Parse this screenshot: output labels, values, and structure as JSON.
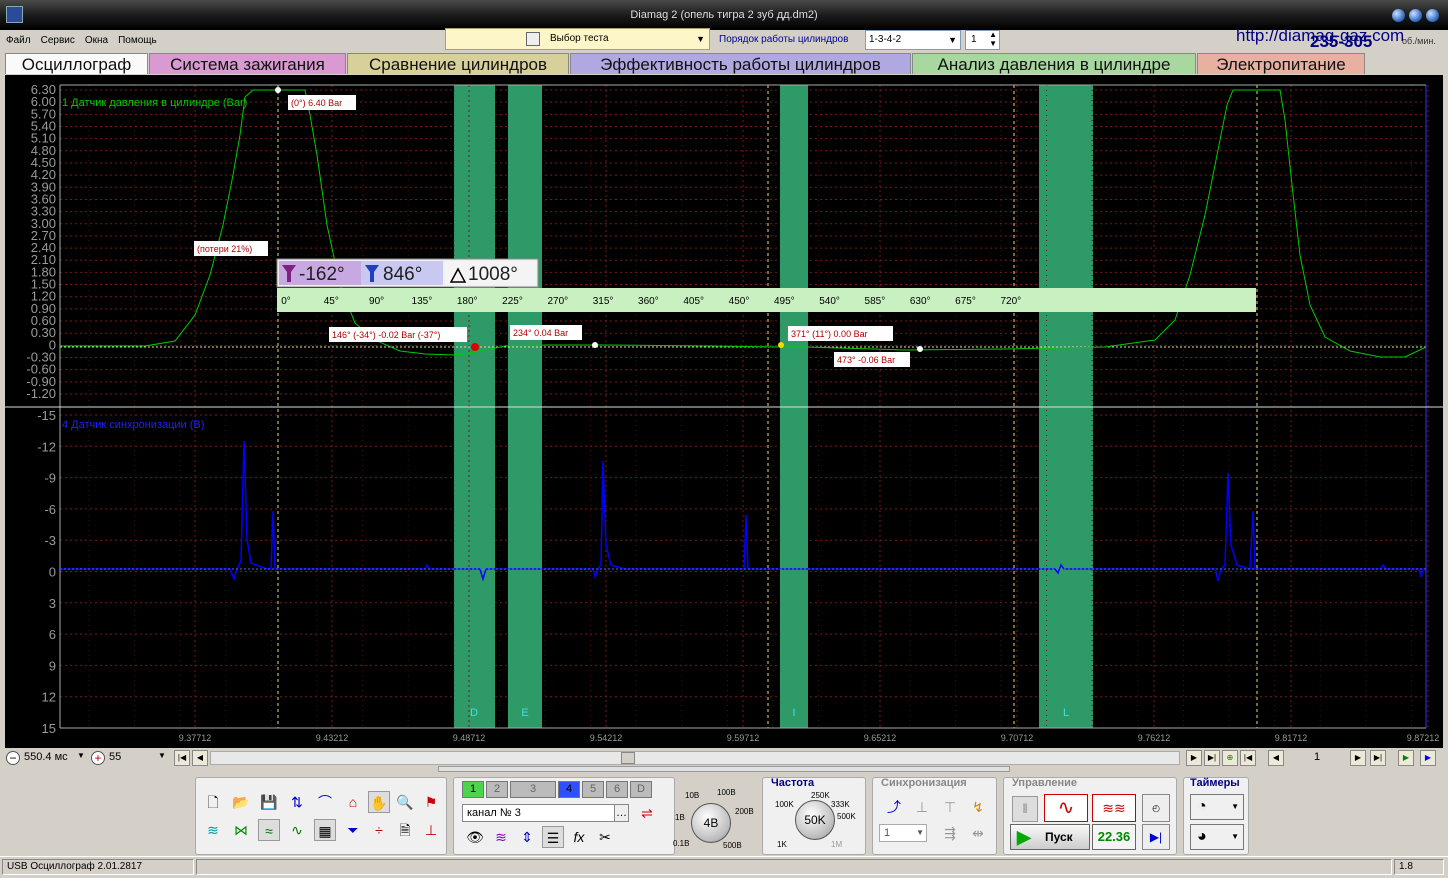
{
  "window": {
    "title": "Diamag 2 (опель тигра 2 зуб дд.dm2)"
  },
  "menu": [
    "Файл",
    "Сервис",
    "Окна",
    "Помощь"
  ],
  "toolbar": {
    "test_select": "Выбор теста",
    "order_label": "Порядок работы цилиндров",
    "order_value": "1-3-4-2",
    "cylinder_value": "1",
    "url": "http://diamag-gaz.com",
    "phone": "235-305",
    "rpm_unit": "об./мин."
  },
  "tabs": [
    {
      "label": "Осциллограф",
      "color": "#f0f0f0"
    },
    {
      "label": "Система зажигания",
      "color": "#d89ad0"
    },
    {
      "label": "Сравнение цилиндров",
      "color": "#d8d09a"
    },
    {
      "label": "Эффективность работы цилиндров",
      "color": "#b0a8e0"
    },
    {
      "label": "Анализ давления в цилиндре",
      "color": "#a8d8a0"
    },
    {
      "label": "Электропитание",
      "color": "#e8b0a0"
    }
  ],
  "scope": {
    "channel1_label": "1 Датчик давления в цилиндре (Bar)",
    "channel2_label": "4 Датчик синхронизации (В)",
    "channel1_color": "#00cc00",
    "channel2_color": "#0000ff",
    "zone_color": "#2e9a68",
    "y1_ticks": [
      "6.30",
      "6.00",
      "5.70",
      "5.40",
      "5.10",
      "4.80",
      "4.50",
      "4.20",
      "3.90",
      "3.60",
      "3.30",
      "3.00",
      "2.70",
      "2.40",
      "2.10",
      "1.80",
      "1.50",
      "1.20",
      "0.90",
      "0.60",
      "0.30",
      "0",
      "-0.30",
      "-0.60",
      "-0.90",
      "-1.20"
    ],
    "y2_ticks": [
      "-15",
      "-12",
      "-9",
      "-6",
      "-3",
      "0",
      "3",
      "6",
      "9",
      "12",
      "15"
    ],
    "x_ticks": [
      "9.37712",
      "9.43212",
      "9.48712",
      "9.54212",
      "9.59712",
      "9.65212",
      "9.70712",
      "9.76212",
      "9.81712",
      "9.87212"
    ],
    "zone_letters": [
      "D",
      "E",
      "I",
      "L"
    ],
    "cursor1": "-162°",
    "cursor2": "846°",
    "delta": "1008°",
    "degree_ticks": [
      "0°",
      "45°",
      "90°",
      "135°",
      "180°",
      "225°",
      "270°",
      "315°",
      "360°",
      "405°",
      "450°",
      "495°",
      "540°",
      "585°",
      "630°",
      "675°",
      "720°"
    ],
    "annotations": [
      "(0°) 6.40 Bar",
      "(потери 21%)",
      "146° (-34°) -0.02 Bar (-37°)",
      "234° 0.04 Bar",
      "371° (11°) 0.00 Bar",
      "473° -0.06 Bar"
    ]
  },
  "controls": {
    "timebase": "550.4 мс",
    "zoom": "55",
    "page": "1",
    "channel_buttons": [
      "1",
      "2",
      "3",
      "4",
      "5",
      "6",
      "D"
    ],
    "channel_select": "канал № 3",
    "freq_title": "Частота",
    "freq_value": "50K",
    "freq_options": [
      "100K",
      "250K",
      "333K",
      "500K",
      "1M",
      "1K"
    ],
    "volt_value": "4В",
    "volt_options": [
      "10В",
      "100В",
      "200В",
      "500В",
      "0.1В",
      "1В"
    ],
    "sync_title": "Синхронизация",
    "sync_value": "1",
    "control_title": "Управление",
    "start_label": "Пуск",
    "time_value": "22.36",
    "timers_title": "Таймеры"
  },
  "status": {
    "left": "USB Осциллограф  2.01.2817",
    "right": "1.8"
  }
}
